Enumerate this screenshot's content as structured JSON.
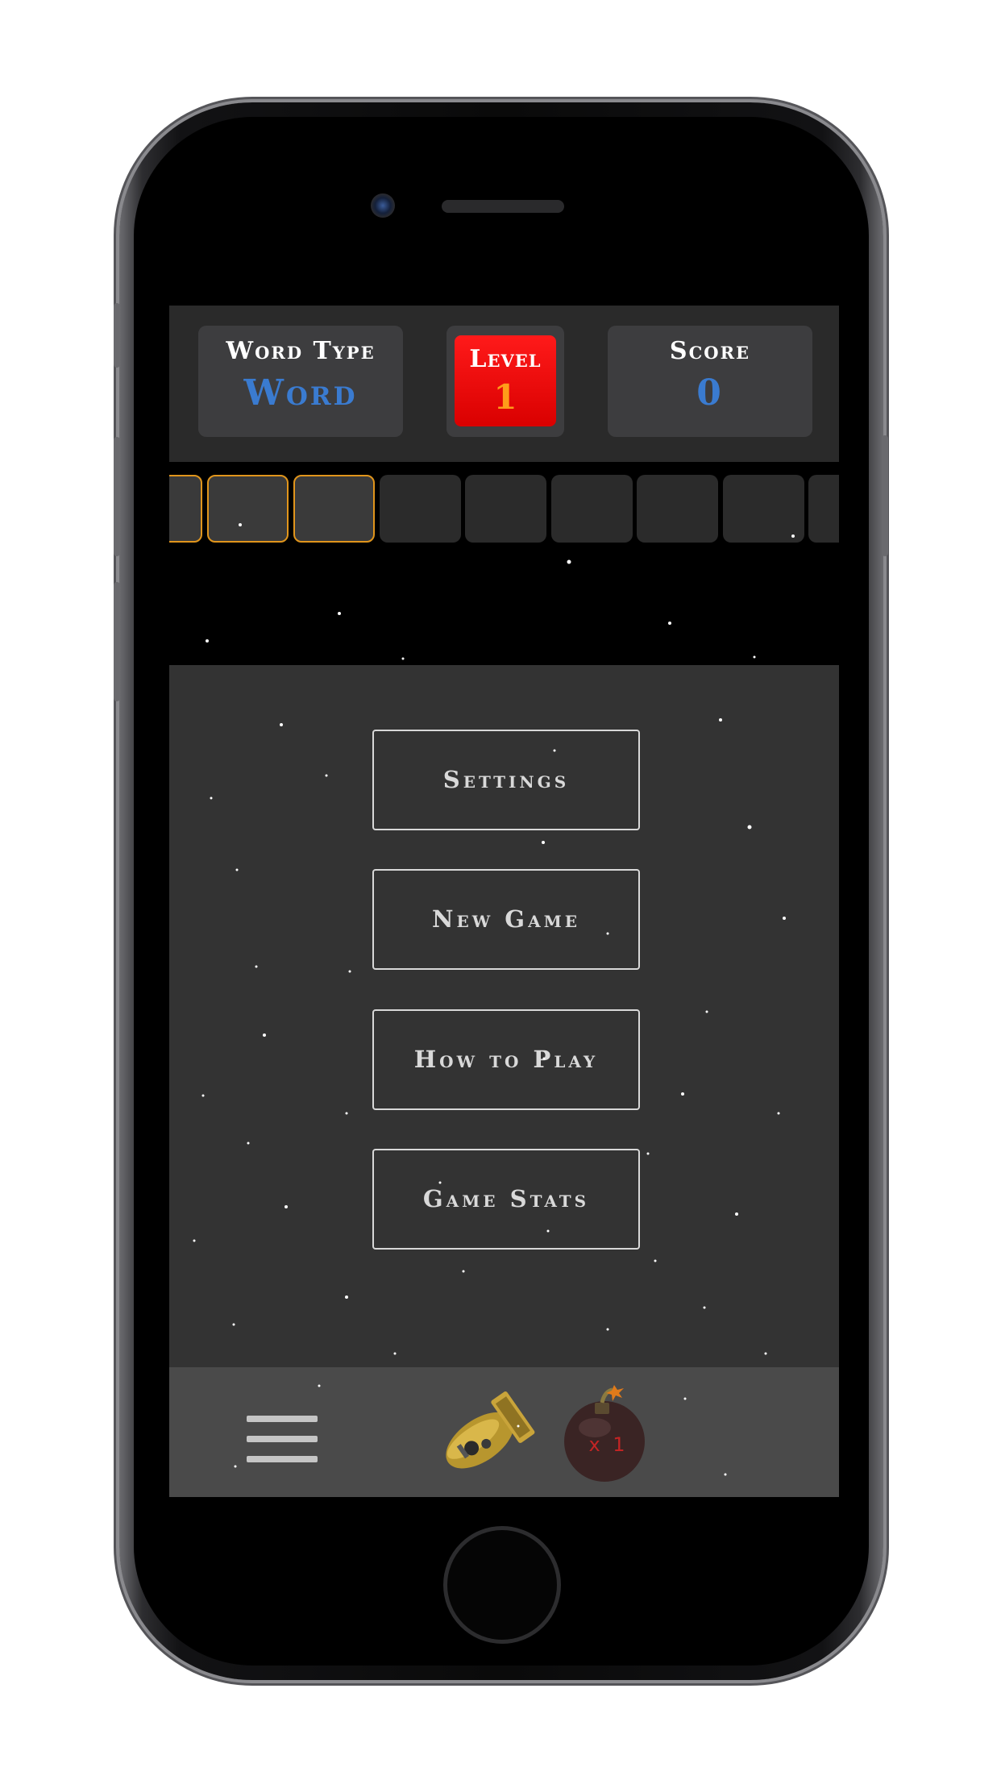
{
  "header": {
    "word_type": {
      "label": "Word Type",
      "value": "Word"
    },
    "level": {
      "label": "Level",
      "value": "1"
    },
    "score": {
      "label": "Score",
      "value": "0"
    }
  },
  "letter_slots": {
    "total_visible": 9,
    "highlighted": 3
  },
  "menu": {
    "settings_label": "Settings",
    "new_game_label": "New Game",
    "how_to_play_label": "How to Play",
    "game_stats_label": "Game Stats"
  },
  "toolbar": {
    "bomb_count": "x 1"
  },
  "colors": {
    "accent_blue": "#3a7bd0",
    "level_red": "#e00000",
    "level_number_orange": "#ff9c1a",
    "slot_highlight": "#e0951c"
  },
  "icons": [
    "menu-icon",
    "rocket-icon",
    "bomb-icon"
  ]
}
